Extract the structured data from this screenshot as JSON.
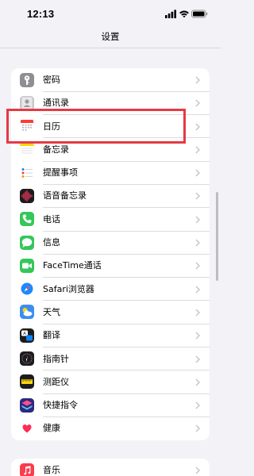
{
  "status_bar": {
    "time": "12:13"
  },
  "nav": {
    "title": "设置"
  },
  "group1": [
    {
      "key": "passwords",
      "label": "密码",
      "icon": "key-icon",
      "color": "#8e8e93"
    },
    {
      "key": "contacts",
      "label": "通讯录",
      "icon": "contacts-icon",
      "color": "#a7a7ac"
    },
    {
      "key": "calendar",
      "label": "日历",
      "icon": "calendar-icon",
      "color": "#ffffff"
    },
    {
      "key": "notes",
      "label": "备忘录",
      "icon": "notes-icon",
      "color": "#ffd60a"
    },
    {
      "key": "reminders",
      "label": "提醒事项",
      "icon": "reminders-icon",
      "color": "#ffffff"
    },
    {
      "key": "voice-memos",
      "label": "语音备忘录",
      "icon": "voice-memos-icon",
      "color": "#1c1c1e"
    },
    {
      "key": "phone",
      "label": "电话",
      "icon": "phone-icon",
      "color": "#34c759"
    },
    {
      "key": "messages",
      "label": "信息",
      "icon": "messages-icon",
      "color": "#34c759"
    },
    {
      "key": "facetime",
      "label": "FaceTime通话",
      "icon": "facetime-icon",
      "color": "#34c759"
    },
    {
      "key": "safari",
      "label": "Safari浏览器",
      "icon": "safari-icon",
      "color": "#1e88ff"
    },
    {
      "key": "weather",
      "label": "天气",
      "icon": "weather-icon",
      "color": "#3a8df5"
    },
    {
      "key": "translate",
      "label": "翻译",
      "icon": "translate-icon",
      "color": "#1c1c1e"
    },
    {
      "key": "compass",
      "label": "指南针",
      "icon": "compass-icon",
      "color": "#1c1c1e"
    },
    {
      "key": "measure",
      "label": "测距仪",
      "icon": "measure-icon",
      "color": "#1c1c1e"
    },
    {
      "key": "shortcuts",
      "label": "快捷指令",
      "icon": "shortcuts-icon",
      "color": "#5a4ee8"
    },
    {
      "key": "health",
      "label": "健康",
      "icon": "health-icon",
      "color": "#ffffff"
    }
  ],
  "group2": [
    {
      "key": "music",
      "label": "音乐",
      "icon": "music-icon",
      "color": "#fa3c4c"
    }
  ],
  "highlight": {
    "target": "calendar",
    "color": "#e53a44"
  }
}
